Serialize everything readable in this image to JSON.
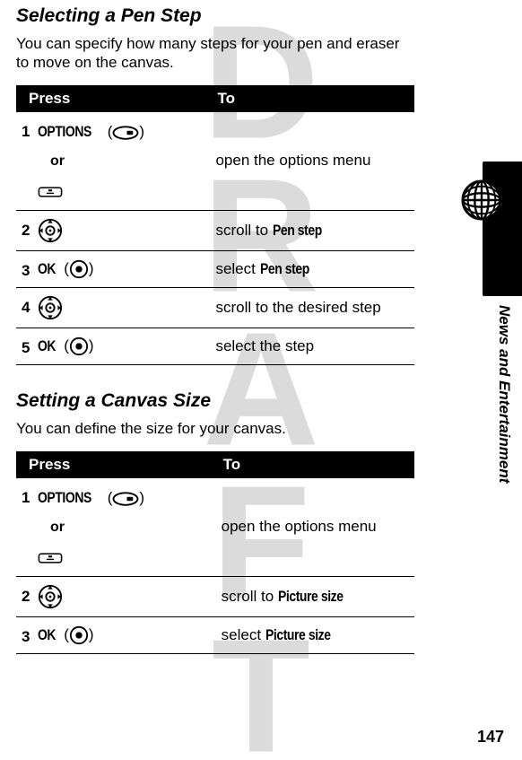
{
  "watermark": "DRAFT",
  "section1": {
    "heading": "Selecting a Pen Step",
    "body": "You can specify how many steps for your pen and eraser to move on the canvas.",
    "table": {
      "head_press": "Press",
      "head_to": "To",
      "rows": [
        {
          "num": "1",
          "key": "OPTIONS",
          "or": "or",
          "to": "open the options menu"
        },
        {
          "num": "2",
          "to_pre": "scroll to ",
          "to_ref": "Pen step"
        },
        {
          "num": "3",
          "key": "OK",
          "to_pre": "select ",
          "to_ref": "Pen step"
        },
        {
          "num": "4",
          "to": "scroll to the desired step"
        },
        {
          "num": "5",
          "key": "OK",
          "to": "select the step"
        }
      ]
    }
  },
  "section2": {
    "heading": "Setting a Canvas Size",
    "body": "You can define the size for your canvas.",
    "table": {
      "head_press": "Press",
      "head_to": "To",
      "rows": [
        {
          "num": "1",
          "key": "OPTIONS",
          "or": "or",
          "to": "open the options menu"
        },
        {
          "num": "2",
          "to_pre": "scroll to ",
          "to_ref": "Picture size"
        },
        {
          "num": "3",
          "key": "OK",
          "to_pre": "select ",
          "to_ref": "Picture size"
        }
      ]
    }
  },
  "side": {
    "label": "News and Entertainment"
  },
  "page_number": "147"
}
